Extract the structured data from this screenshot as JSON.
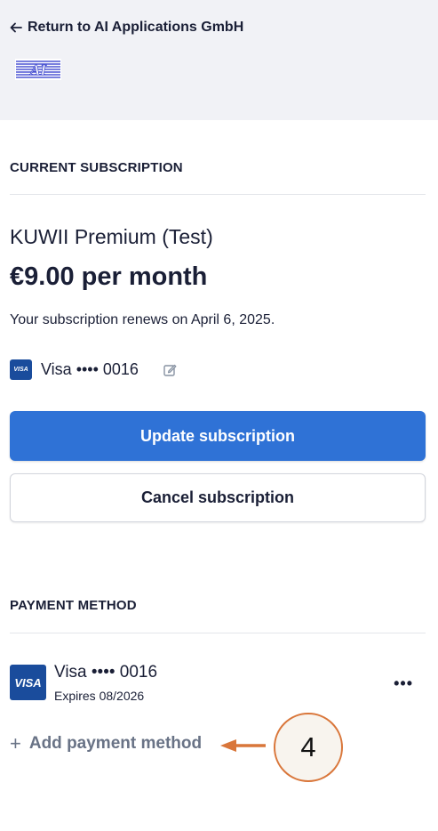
{
  "header": {
    "back_label": "Return to AI Applications GmbH",
    "logo_text": "AI"
  },
  "subscription": {
    "section_title": "CURRENT SUBSCRIPTION",
    "plan_name": "KUWII Premium (Test)",
    "price": "€9.00 per month",
    "renewal_text": "Your subscription renews on April 6, 2025.",
    "card_brand_badge": "VISA",
    "card_label": "Visa •••• 0016",
    "update_button": "Update subscription",
    "cancel_button": "Cancel subscription"
  },
  "payment_method": {
    "section_title": "PAYMENT METHOD",
    "card_brand_badge": "VISA",
    "card_label": "Visa •••• 0016",
    "expiry": "Expires 08/2026",
    "more_label": "•••",
    "add_label": "Add payment method"
  },
  "annotation": {
    "step_number": "4",
    "color": "#d9763a"
  },
  "colors": {
    "primary": "#2f72d6",
    "visa_blue": "#1a4c9c",
    "muted_text": "#697386",
    "header_bg": "#f1f2f6"
  },
  "icons": {
    "back": "left-arrow-icon",
    "edit": "edit-icon",
    "add": "plus-icon",
    "more": "more-horizontal-icon"
  }
}
